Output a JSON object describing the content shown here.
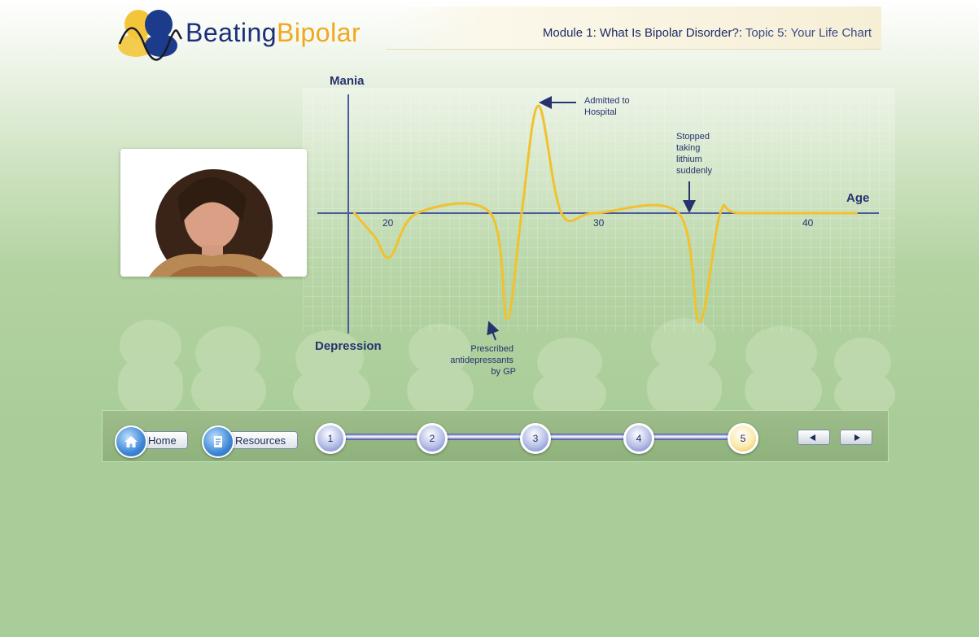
{
  "header": {
    "logo_part1": "Beating",
    "logo_part2": "Bipolar",
    "module": "Module 1: What Is Bipolar Disorder?:",
    "topic": " Topic 5: Your Life Chart"
  },
  "chart": {
    "y_top_label": "Mania",
    "y_bottom_label": "Depression",
    "x_label": "Age",
    "ticks": [
      "20",
      "30",
      "40"
    ],
    "annotations": {
      "hospital": [
        "Admitted to",
        "Hospital"
      ],
      "lithium": [
        "Stopped",
        "taking",
        "lithium",
        "suddenly"
      ],
      "antidepressants": [
        "Prescribed",
        "antidepressants",
        "by GP"
      ]
    },
    "colors": {
      "curve": "#f2c12e",
      "axes": "#4a5a9a",
      "text": "#26336e"
    }
  },
  "chart_data": {
    "type": "line",
    "x": [
      18.5,
      19.5,
      20.2,
      21.5,
      25,
      25.8,
      26.5,
      27.3,
      28.4,
      30,
      34,
      35,
      36,
      37,
      42.5
    ],
    "y": [
      0,
      -1.5,
      -2.7,
      0,
      0,
      -6.5,
      0,
      6.6,
      0,
      0,
      0,
      -6.7,
      0,
      0,
      0
    ],
    "xlabel": "Age",
    "ylabel_top": "Mania",
    "ylabel_bottom": "Depression",
    "xlim": [
      16.5,
      44
    ],
    "grid": true
  },
  "navigation": {
    "home_label": "Home",
    "resources_label": "Resources",
    "steps": [
      "1",
      "2",
      "3",
      "4",
      "5"
    ],
    "active_step": "5"
  },
  "icons": {
    "home": "home-icon",
    "resources": "document-icon",
    "prev": "arrow-left-icon",
    "next": "arrow-right-icon"
  }
}
